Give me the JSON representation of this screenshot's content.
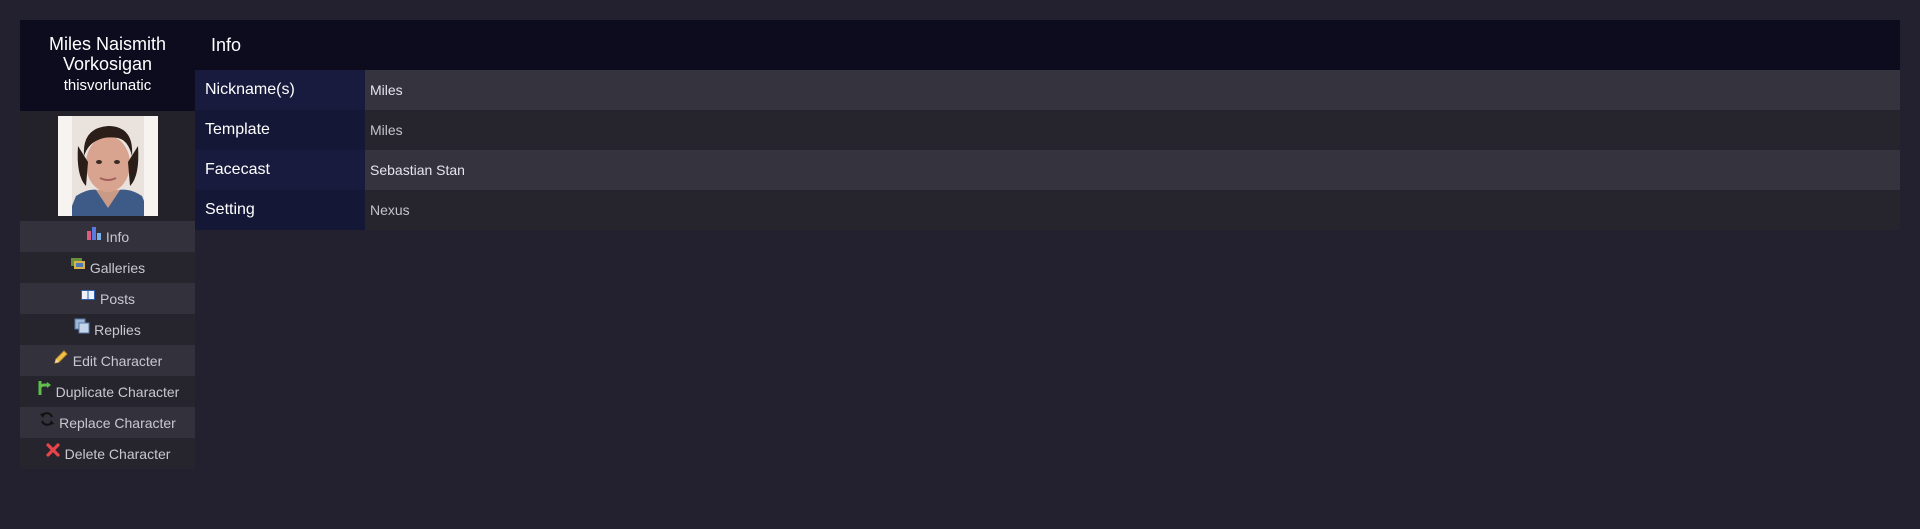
{
  "character": {
    "name": "Miles Naismith Vorkosigan",
    "username": "thisvorlunatic"
  },
  "menu": {
    "items": [
      {
        "label": "Info",
        "icon": "info-chart-icon"
      },
      {
        "label": "Galleries",
        "icon": "galleries-icon"
      },
      {
        "label": "Posts",
        "icon": "book-icon"
      },
      {
        "label": "Replies",
        "icon": "replies-icon"
      },
      {
        "label": "Edit Character",
        "icon": "pencil-icon"
      },
      {
        "label": "Duplicate Character",
        "icon": "branch-icon"
      },
      {
        "label": "Replace Character",
        "icon": "refresh-icon"
      },
      {
        "label": "Delete Character",
        "icon": "delete-x-icon"
      }
    ]
  },
  "main": {
    "title": "Info",
    "rows": [
      {
        "label": "Nickname(s)",
        "value": "Miles"
      },
      {
        "label": "Template",
        "value": "Miles"
      },
      {
        "label": "Facecast",
        "value": "Sebastian Stan"
      },
      {
        "label": "Setting",
        "value": "Nexus"
      }
    ]
  },
  "colors": {
    "background": "#23202f",
    "header": "#0d0c1f",
    "label_column": "#181b3e"
  }
}
